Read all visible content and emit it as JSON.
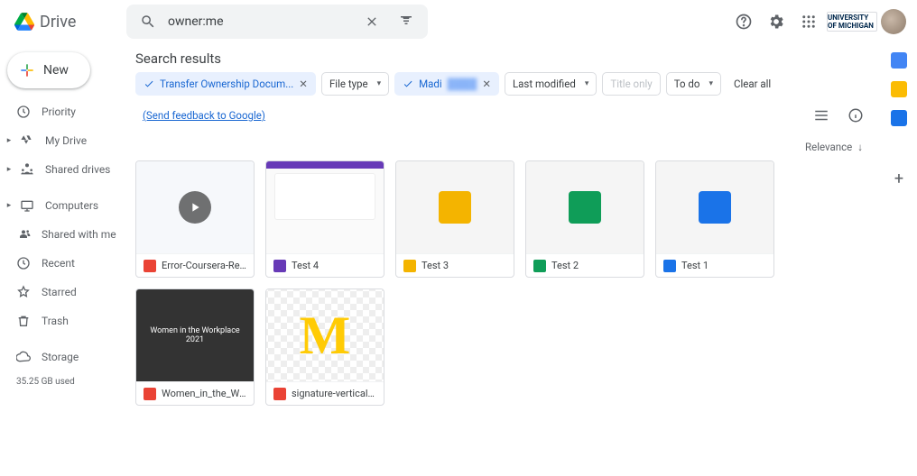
{
  "header": {
    "app_name": "Drive",
    "search_value": "owner:me",
    "brand_label": "UNIVERSITY OF MICHIGAN"
  },
  "sidebar": {
    "new_label": "New",
    "items": [
      {
        "label": "Priority",
        "icon": "priority"
      },
      {
        "label": "My Drive",
        "icon": "mydrive",
        "expandable": true
      },
      {
        "label": "Shared drives",
        "icon": "shareddrives",
        "expandable": true
      },
      {
        "label": "Computers",
        "icon": "computers",
        "expandable": true
      },
      {
        "label": "Shared with me",
        "icon": "shared"
      },
      {
        "label": "Recent",
        "icon": "recent"
      },
      {
        "label": "Starred",
        "icon": "starred"
      },
      {
        "label": "Trash",
        "icon": "trash"
      },
      {
        "label": "Storage",
        "icon": "storage"
      }
    ],
    "storage_used": "35.25 GB used"
  },
  "content": {
    "title": "Search results",
    "chips": {
      "transfer_label": "Transfer Ownership Docum...",
      "filetype_label": "File type",
      "person_label": "Madi",
      "lastmod_label": "Last modified",
      "titleonly_label": "Title only",
      "todo_label": "To do",
      "clearall_label": "Clear all",
      "feedback_label": "(Send feedback to Google)"
    },
    "sort_label": "Relevance",
    "files": [
      {
        "name": "Error-Coursera-Results.we...",
        "type": "video"
      },
      {
        "name": "Test 4",
        "type": "form"
      },
      {
        "name": "Test 3",
        "type": "slides"
      },
      {
        "name": "Test 2",
        "type": "sheets"
      },
      {
        "name": "Test 1",
        "type": "docs"
      },
      {
        "name": "Women_in_the_Workplace_...",
        "type": "pdf",
        "thumb_text": "Women in the Workplace 2021"
      },
      {
        "name": "signature-vertical-white.png",
        "type": "image"
      }
    ]
  }
}
